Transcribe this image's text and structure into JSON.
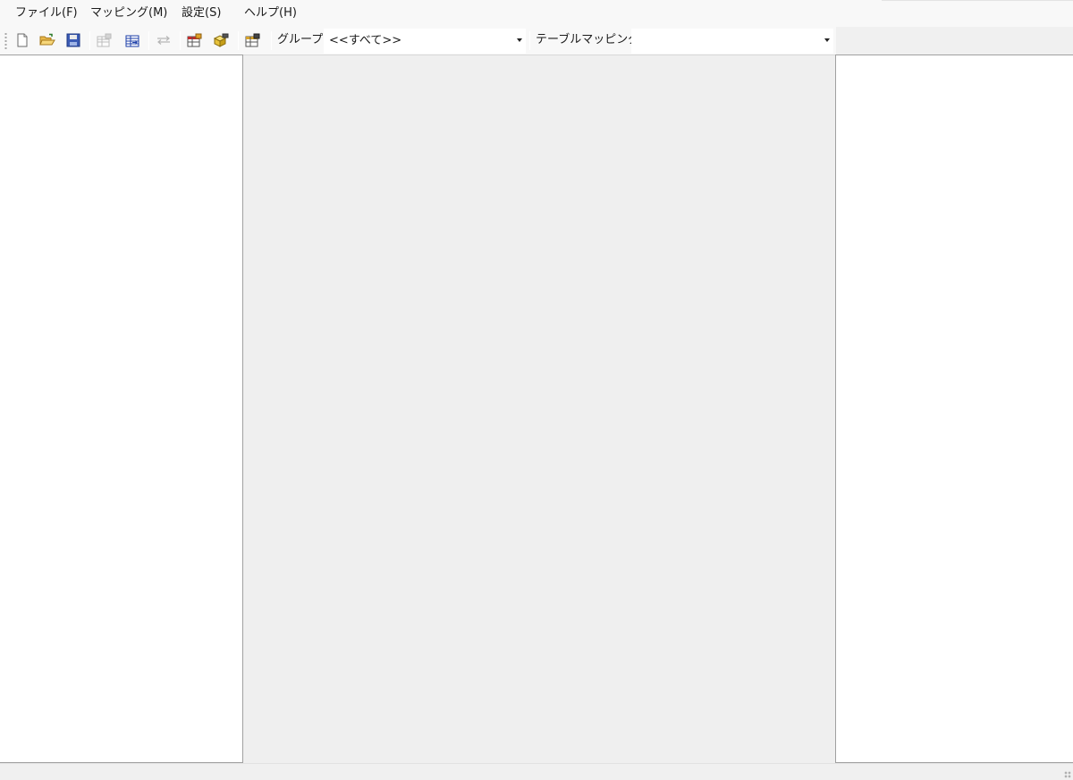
{
  "menu": {
    "file": "ファイル(F)",
    "mapping": "マッピング(M)",
    "settings": "設定(S)",
    "help": "ヘルプ(H)"
  },
  "toolbar": {
    "buttons": [
      {
        "icon": "new-file-icon",
        "enabled": true
      },
      {
        "icon": "open-folder-icon",
        "enabled": true
      },
      {
        "icon": "save-icon",
        "enabled": true
      },
      {
        "icon": "table-properties-icon",
        "enabled": false
      },
      {
        "icon": "table-mapping-icon",
        "enabled": true
      },
      {
        "icon": "link-arrows-icon",
        "enabled": false
      },
      {
        "icon": "table-edit-icon",
        "enabled": true
      },
      {
        "icon": "yellow-box-icon",
        "enabled": true
      },
      {
        "icon": "table-settings-icon",
        "enabled": true
      }
    ],
    "group_label": "グループ",
    "group_value": "<<すべて>>",
    "table_mapping_label": "テーブルマッピング",
    "table_mapping_value": ""
  },
  "colors": {
    "window_bg": "#f0f0f0",
    "pane_bg": "#ffffff",
    "center_bg": "#efefef"
  }
}
